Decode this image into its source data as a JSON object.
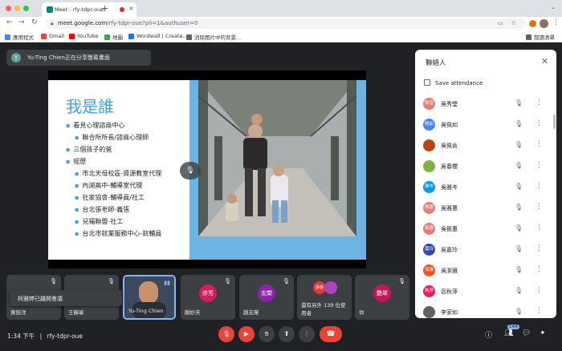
{
  "browser": {
    "tab_title": "Meet - rfy-tdpr-oue",
    "tab_close": "×",
    "new_tab": "+",
    "url_host": "meet.google.com",
    "url_path": "/rfy-tdpr-oue?pli=1&authuser=0",
    "menu": "⋮",
    "bookmarks": [
      "應用程式",
      "Gmail",
      "YouTube",
      "地圖",
      "Wordwall | Create...",
      "消除图片中的背景..."
    ],
    "reading_list": "閱讀清單"
  },
  "meet": {
    "presenter_initial": "Y",
    "presenter_text": "Yu-Ting Chien正在分享螢幕畫面",
    "slide": {
      "title": "我是誰",
      "lines": [
        {
          "level": 1,
          "text": "看見心理諮商中心"
        },
        {
          "level": 2,
          "text": "聯合所所長/諮商心理師"
        },
        {
          "level": 1,
          "text": "三個孩子的爸"
        },
        {
          "level": 1,
          "text": "經歷"
        },
        {
          "level": 2,
          "text": "市北天母校區-資源教室代理"
        },
        {
          "level": 2,
          "text": "內湖高中-輔導室代理"
        },
        {
          "level": 2,
          "text": "社家協會-輔導員/社工"
        },
        {
          "level": 2,
          "text": "台北張老師-義張"
        },
        {
          "level": 2,
          "text": "兒福聯盟-社工"
        },
        {
          "level": 2,
          "text": "台北市就業服務中心-就輔員"
        }
      ]
    },
    "panel": {
      "title": "聯絡人",
      "close": "✕",
      "save_attendance": "Save attendance",
      "participants": [
        {
          "avatar": "秀瑩",
          "name": "吳秀瑩",
          "color": "#e67c73"
        },
        {
          "avatar": "佩如",
          "name": "吳佩如",
          "color": "#4285f4"
        },
        {
          "avatar": "",
          "name": "吳佩俞",
          "color": "#c2410c"
        },
        {
          "avatar": "",
          "name": "吳春櫻",
          "color": "#7cb342"
        },
        {
          "avatar": "雅岑",
          "name": "吳雅岑",
          "color": "#039be5"
        },
        {
          "avatar": "雅惠",
          "name": "吳雅惠",
          "color": "#e67c73"
        },
        {
          "avatar": "筱惠",
          "name": "吳筱惠",
          "color": "#e67c73"
        },
        {
          "avatar": "嘉玲",
          "name": "吳嘉玲",
          "color": "#3949ab"
        },
        {
          "avatar": "潔雅",
          "name": "吳潔雅",
          "color": "#f4511e"
        },
        {
          "avatar": "秋萍",
          "name": "呂秋萍",
          "color": "#e91e63"
        },
        {
          "avatar": "",
          "name": "李家如",
          "color": "#616161"
        }
      ]
    },
    "tiles": [
      {
        "name": "黃鈺洋",
        "avatar": ""
      },
      {
        "name": "王靜瑜",
        "avatar": ""
      },
      {
        "name": "Yu-Ting Chien",
        "avatar": ""
      },
      {
        "name": "顏妙芳",
        "avatar": "妙芳"
      },
      {
        "name": "趙志榮",
        "avatar": "志榮"
      },
      {
        "name": "還有另外 139 位使用者",
        "avatar": "詩春"
      },
      {
        "name": "你",
        "avatar": "艷翠"
      }
    ],
    "toast": "柯雅婷已離開會議",
    "clock": "1:34 下午",
    "separator": "|",
    "meeting_code": "rfy-tdpr-oue",
    "people_count": "144"
  }
}
